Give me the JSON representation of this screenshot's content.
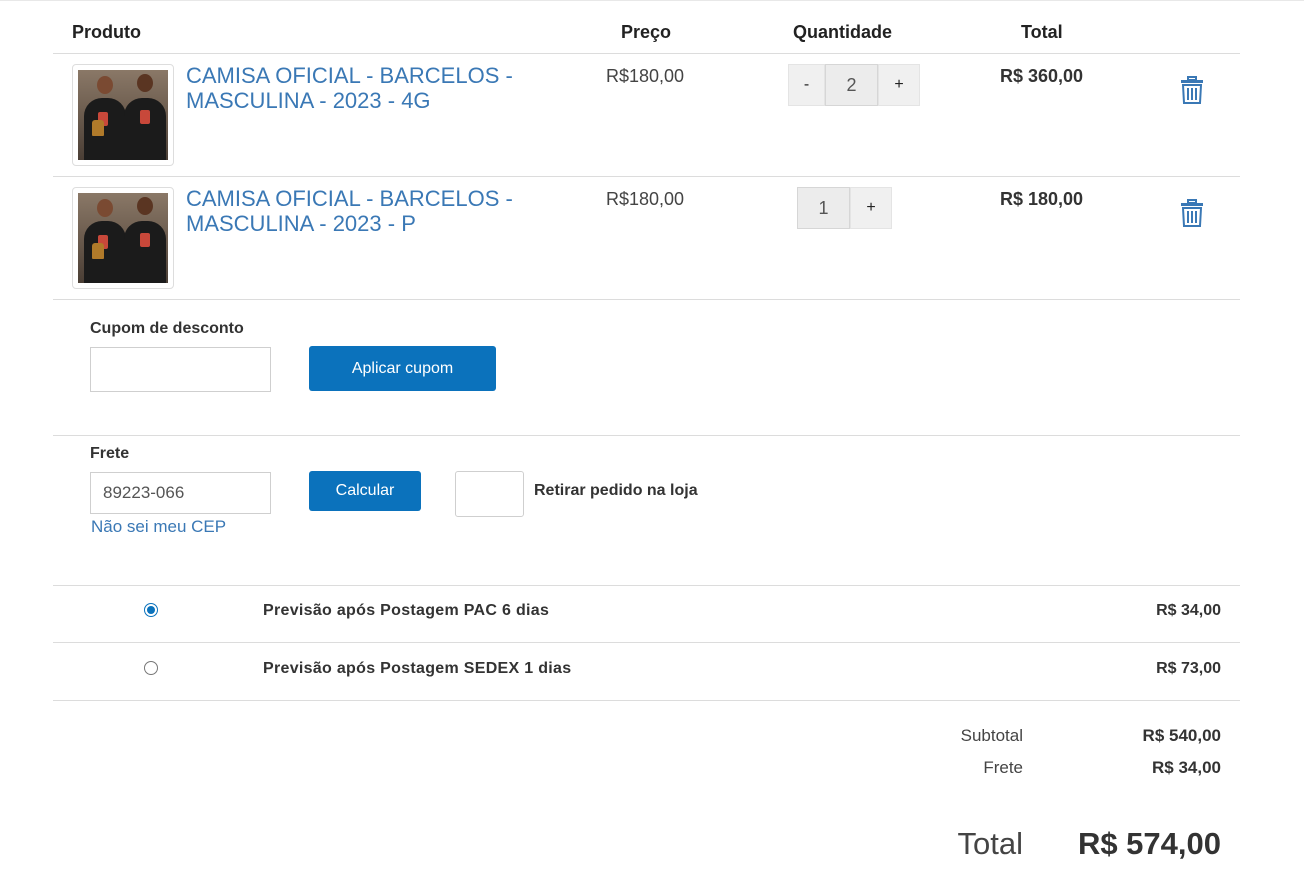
{
  "headers": {
    "product": "Produto",
    "price": "Preço",
    "quantity": "Quantidade",
    "total": "Total"
  },
  "items": [
    {
      "name": "CAMISA OFICIAL - BARCELOS - MASCULINA - 2023 - 4G",
      "price": "R$180,00",
      "qty_minus": "-",
      "qty": "2",
      "qty_plus": "+",
      "total": "R$ 360,00",
      "image_icon": "product-photo"
    },
    {
      "name": "CAMISA OFICIAL - BARCELOS - MASCULINA - 2023 - P",
      "price": "R$180,00",
      "qty": "1",
      "qty_plus": "+",
      "total": "R$ 180,00",
      "image_icon": "product-photo"
    }
  ],
  "coupon": {
    "label": "Cupom de desconto",
    "value": "",
    "button": "Aplicar cupom"
  },
  "shipping": {
    "label": "Frete",
    "cep_value": "89223-066",
    "calc_button": "Calcular",
    "cep_link": "Não sei meu CEP",
    "pickup_label": "Retirar pedido na loja",
    "options": [
      {
        "name": "Previsão após Postagem PAC 6 dias",
        "price": "R$ 34,00",
        "selected": true
      },
      {
        "name": "Previsão após Postagem SEDEX 1 dias",
        "price": "R$ 73,00",
        "selected": false
      }
    ]
  },
  "summary": {
    "subtotal_label": "Subtotal",
    "subtotal_value": "R$ 540,00",
    "freight_label": "Frete",
    "freight_value": "R$ 34,00",
    "total_label": "Total",
    "total_value": "R$ 574,00"
  },
  "colors": {
    "accent": "#0b72bc",
    "link": "#3a78b5",
    "trash": "#3a78b5"
  }
}
